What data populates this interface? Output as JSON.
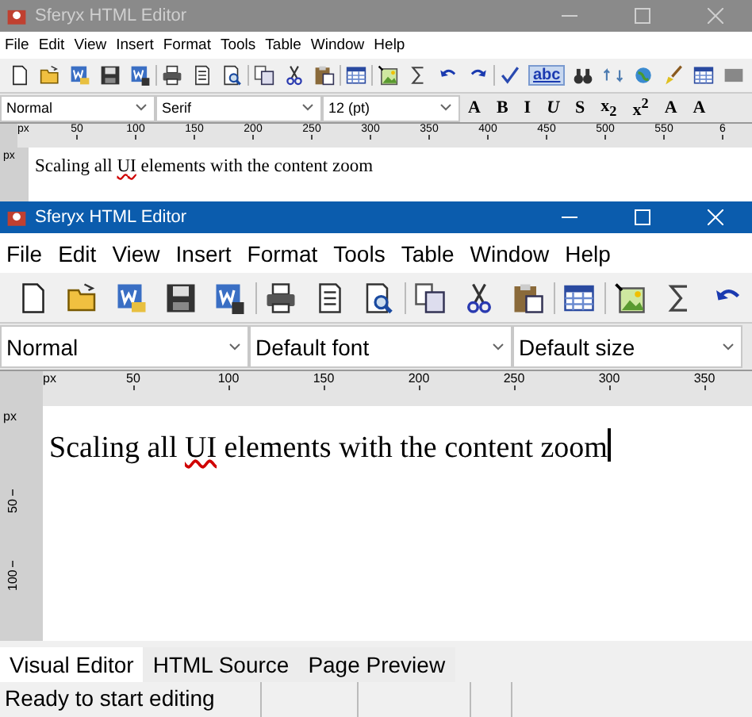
{
  "windows": [
    {
      "title": "Sferyx HTML Editor",
      "active": false,
      "menu": [
        "File",
        "Edit",
        "View",
        "Insert",
        "Format",
        "Tools",
        "Table",
        "Window",
        "Help"
      ],
      "toolbar_toggle": {
        "label": "abc",
        "on": true
      },
      "combos": [
        {
          "value": "Normal"
        },
        {
          "value": "Serif"
        },
        {
          "value": "12 (pt)"
        }
      ],
      "format_buttons": [
        "A",
        "B",
        "I",
        "U",
        "S",
        "x$_{2}$",
        "x$^{2}$",
        "A",
        "A"
      ],
      "ruler": {
        "unit": "px",
        "ticks": [
          "50",
          "100",
          "150",
          "200",
          "250",
          "300",
          "350",
          "400",
          "450",
          "500",
          "550",
          "6"
        ]
      },
      "vertical_ruler": {
        "unit": "px"
      },
      "document": [
        {
          "text": "Scaling all ",
          "misspelled": false
        },
        {
          "text": "UI",
          "misspelled": true
        },
        {
          "text": " elements with the content zoom",
          "misspelled": false
        }
      ]
    },
    {
      "title": "Sferyx HTML Editor",
      "active": true,
      "menu": [
        "File",
        "Edit",
        "View",
        "Insert",
        "Format",
        "Tools",
        "Table",
        "Window",
        "Help"
      ],
      "combos": [
        {
          "value": "Normal"
        },
        {
          "value": "Default font"
        },
        {
          "value": "Default size"
        }
      ],
      "ruler": {
        "unit": "px",
        "ticks": [
          "50",
          "100",
          "150",
          "200",
          "250",
          "300",
          "350"
        ]
      },
      "vertical_ruler": {
        "unit": "px",
        "ticks": [
          "50",
          "100"
        ]
      },
      "document": [
        {
          "text": "Scaling all ",
          "misspelled": false
        },
        {
          "text": "UI",
          "misspelled": true
        },
        {
          "text": " elements with the content zoom",
          "misspelled": false
        }
      ],
      "cursor": true,
      "tabs": [
        {
          "label": "Visual Editor",
          "selected": true
        },
        {
          "label": "HTML Source",
          "selected": false
        },
        {
          "label": "Page Preview",
          "selected": false
        }
      ],
      "status_bar": {
        "message": "Ready to start editing"
      }
    }
  ]
}
